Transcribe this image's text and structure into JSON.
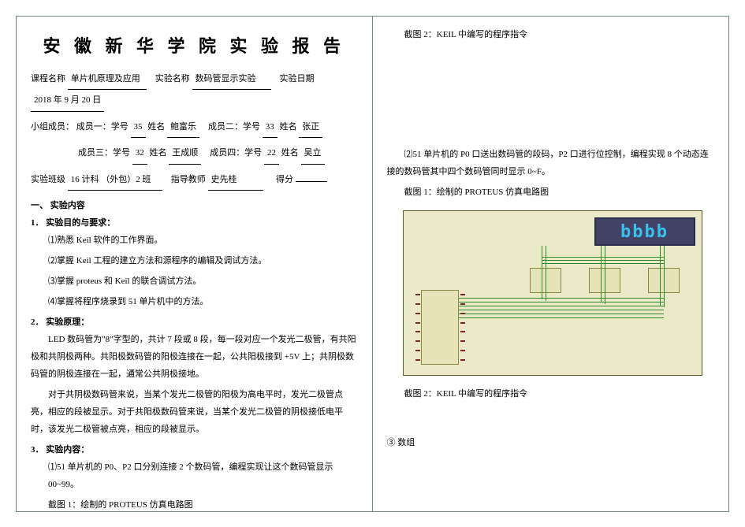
{
  "header": {
    "title": "安 徽 新 华 学 院 实 验 报 告"
  },
  "meta": {
    "course_label": "课程名称",
    "course_value": "单片机原理及应用",
    "exp_label": "实验名称",
    "exp_value": "数码管显示实验",
    "date_label": "实验日期",
    "date_value": "2018 年 9 月 20 日"
  },
  "group": {
    "line_label": "小组成员：",
    "m1_label": "成员一：学号",
    "m1_id": "35",
    "m1_name_label": "姓名",
    "m1_name": "鲍富乐",
    "m2_label": "成员二：学号",
    "m2_id": "33",
    "m2_name_label": "姓名",
    "m2_name": "张正",
    "m3_label": "成员三：学号",
    "m3_id": "32",
    "m3_name_label": "姓名",
    "m3_name": "王成顺",
    "m4_label": "成员四：学号",
    "m4_id": "22",
    "m4_name_label": "姓名",
    "m4_name": "吴立"
  },
  "class": {
    "class_label": "实验班级",
    "class_value": "16 计科 （外包）2 班",
    "teacher_label": "指导教师",
    "teacher_value": "史先桂",
    "score_label": "得分"
  },
  "sections": {
    "s1": "一、 实验内容",
    "s1_1": "1． 实验目的与要求：",
    "s1_1_items": [
      "⑴熟悉 Keil 软件的工作界面。",
      "⑵掌握 Keil 工程的建立方法和源程序的编辑及调试方法。",
      "⑶掌握 proteus 和 Keil 的联合调试方法。",
      "⑷掌握将程序烧录到 51 单片机中的方法。"
    ],
    "s1_2": "2． 实验原理：",
    "s1_2_p1": "LED 数码管为\"8\"字型的，共计 7 段或 8 段，每一段对应一个发光二极管，有共阳极和共阴极两种。共阳极数码管的阳极连接在一起，公共阳极接到 +5V 上；共阴极数码管的阴极连接在一起，通常公共阴极接地。",
    "s1_2_p2": "对于共阴极数码管来说，当某个发光二极管的阳极为高电平时，发光二极管点亮，相应的段被显示。对于共阳极数码管来说，当某个发光二极管的阴极接低电平时，该发光二极管被点亮，相应的段被显示。",
    "s1_3": "3． 实验内容：",
    "s1_3_item1": "⑴51 单片机的 P0、P2 口分别连接 2 个数码管，编程实现让这个数码管显示 00~99。",
    "s1_3_cap1": "截图 1：绘制的 PROTEUS 仿真电路图"
  },
  "right": {
    "cap_top": "截图 2：KEIL 中编写的程序指令",
    "item2": "⑵51 单片机的 P0 口送出数码管的段码，P2 口进行位控制，编程实现 8 个动态连接的数码管其中四个数码管同时显示 0~F。",
    "cap_fig1": "截图 1：绘制的 PROTEUS 仿真电路图",
    "seg_text": "bbbb",
    "cap_fig2": "截图 2：KEIL 中编写的程序指令",
    "footer_item": "③ 数组"
  }
}
